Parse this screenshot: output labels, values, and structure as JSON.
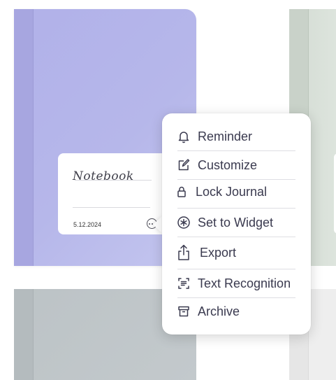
{
  "notebook": {
    "title": "Notebook",
    "date": "5.12.2024",
    "cover_color": "#b4b5ea"
  },
  "context_menu": {
    "items": [
      {
        "label": "Reminder",
        "icon": "bell-icon"
      },
      {
        "label": "Customize",
        "icon": "edit-square-icon"
      },
      {
        "label": "Lock Journal",
        "icon": "lock-icon"
      },
      {
        "label": "Set to Widget",
        "icon": "asterisk-circle-icon"
      },
      {
        "label": "Export",
        "icon": "share-icon"
      },
      {
        "label": "Text Recognition",
        "icon": "text-scan-icon"
      },
      {
        "label": "Archive",
        "icon": "archive-box-icon"
      }
    ]
  },
  "colors": {
    "menu_text": "#3a3a4f",
    "separator": "#dedee3"
  }
}
